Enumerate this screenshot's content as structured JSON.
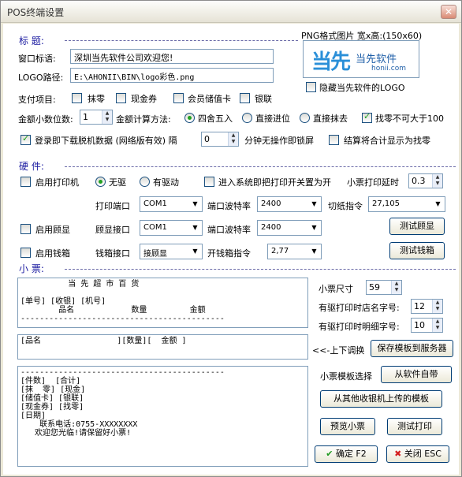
{
  "window": {
    "title": "POS终端设置",
    "close": "✕"
  },
  "sections": {
    "title_sec": "标    题:",
    "hardware": "硬    件:",
    "receipt": "小    票:"
  },
  "title_section": {
    "window_title_label": "窗口标语:",
    "window_title_value": "深圳当先软件公司欢迎您!",
    "logo_path_label": "LOGO路径:",
    "logo_path_value": "E:\\AHONII\\BIN\\logo彩色.png",
    "png_hint": "PNG格式图片 宽x高:(150x60)",
    "logo_text_main": "当先",
    "logo_text_right": "当先软件",
    "logo_url": "honii.com",
    "hide_logo_label": "隐藏当先软件的LOGO",
    "hide_logo_checked": false
  },
  "payment": {
    "label": "支付项目:",
    "items": [
      {
        "label": "抹零",
        "checked": false
      },
      {
        "label": "现金券",
        "checked": false
      },
      {
        "label": "会员储值卡",
        "checked": false
      },
      {
        "label": "银联",
        "checked": false
      }
    ]
  },
  "amount": {
    "decimals_label": "金额小数位数:",
    "decimals_value": "1",
    "calc_label": "金额计算方法:",
    "methods": [
      {
        "label": "四舍五入",
        "checked": true
      },
      {
        "label": "直接进位",
        "checked": false
      },
      {
        "label": "直接抹去",
        "checked": false
      }
    ],
    "change_limit_label": "找零不可大于100",
    "change_limit_checked": true
  },
  "login": {
    "download_label": "登录即下载脱机数据 (网络版有效) 隔",
    "download_checked": true,
    "interval_value": "0",
    "lock_label": "分钟无操作即锁屏",
    "sum_label": "结算将合计显示为找零",
    "sum_checked": false
  },
  "hardware": {
    "enable_printer_label": "启用打印机",
    "enable_printer_checked": false,
    "no_driver_label": "无驱",
    "has_driver_label": "有驱动",
    "driver_mode": "no_driver",
    "open_on_enter_label": "进入系统即把打印开关置为开",
    "open_on_enter_checked": false,
    "print_delay_label": "小票打印延时",
    "print_delay_value": "0.3",
    "print_port_label": "打印端口",
    "print_port_value": "COM1",
    "baud1_label": "端口波特率",
    "baud1_value": "2400",
    "cut_label": "切纸指令",
    "cut_value": "27,105",
    "enable_display_label": "启用顾显",
    "enable_display_checked": false,
    "display_port_label": "顾显接口",
    "display_port_value": "COM1",
    "baud2_label": "端口波特率",
    "baud2_value": "2400",
    "test_display": "测试顾显",
    "enable_drawer_label": "启用钱箱",
    "enable_drawer_checked": false,
    "drawer_port_label": "钱箱接口",
    "drawer_port_value": "接顾显",
    "drawer_cmd_label": "开钱箱指令",
    "drawer_cmd_value": "2,77",
    "test_drawer": "测试钱箱"
  },
  "receipt": {
    "header_text": "          当 先 超 市 百 货\n\n[单号] [收银] [机号]\n        品名            数量         金额\n-------------------------------------------",
    "item_text": "[品名                ][数量][  金额 ]",
    "footer_text": "-------------------------------------------\n[件数]  [合计]\n[抹  零] [现金]\n[储值卡] [银联]\n[现金券] [找零]\n[日期]\n    联系电话:0755-XXXXXXXX\n   欢迎您光临!请保留好小票!",
    "size_label": "小票尺寸",
    "size_value": "59",
    "shop_font_label": "有驱打印时店名字号:",
    "shop_font_value": "12",
    "detail_font_label": "有驱打印时明细字号:",
    "detail_font_value": "10",
    "swap_label": "<<-上下调换",
    "save_template": "保存模板到服务器",
    "template_select_label": "小票模板选择",
    "from_software": "从软件自带",
    "from_other": "从其他收银机上传的模板",
    "preview": "预览小票",
    "test_print": "测试打印",
    "ok": "确定 F2",
    "close": "关闭 ESC"
  }
}
